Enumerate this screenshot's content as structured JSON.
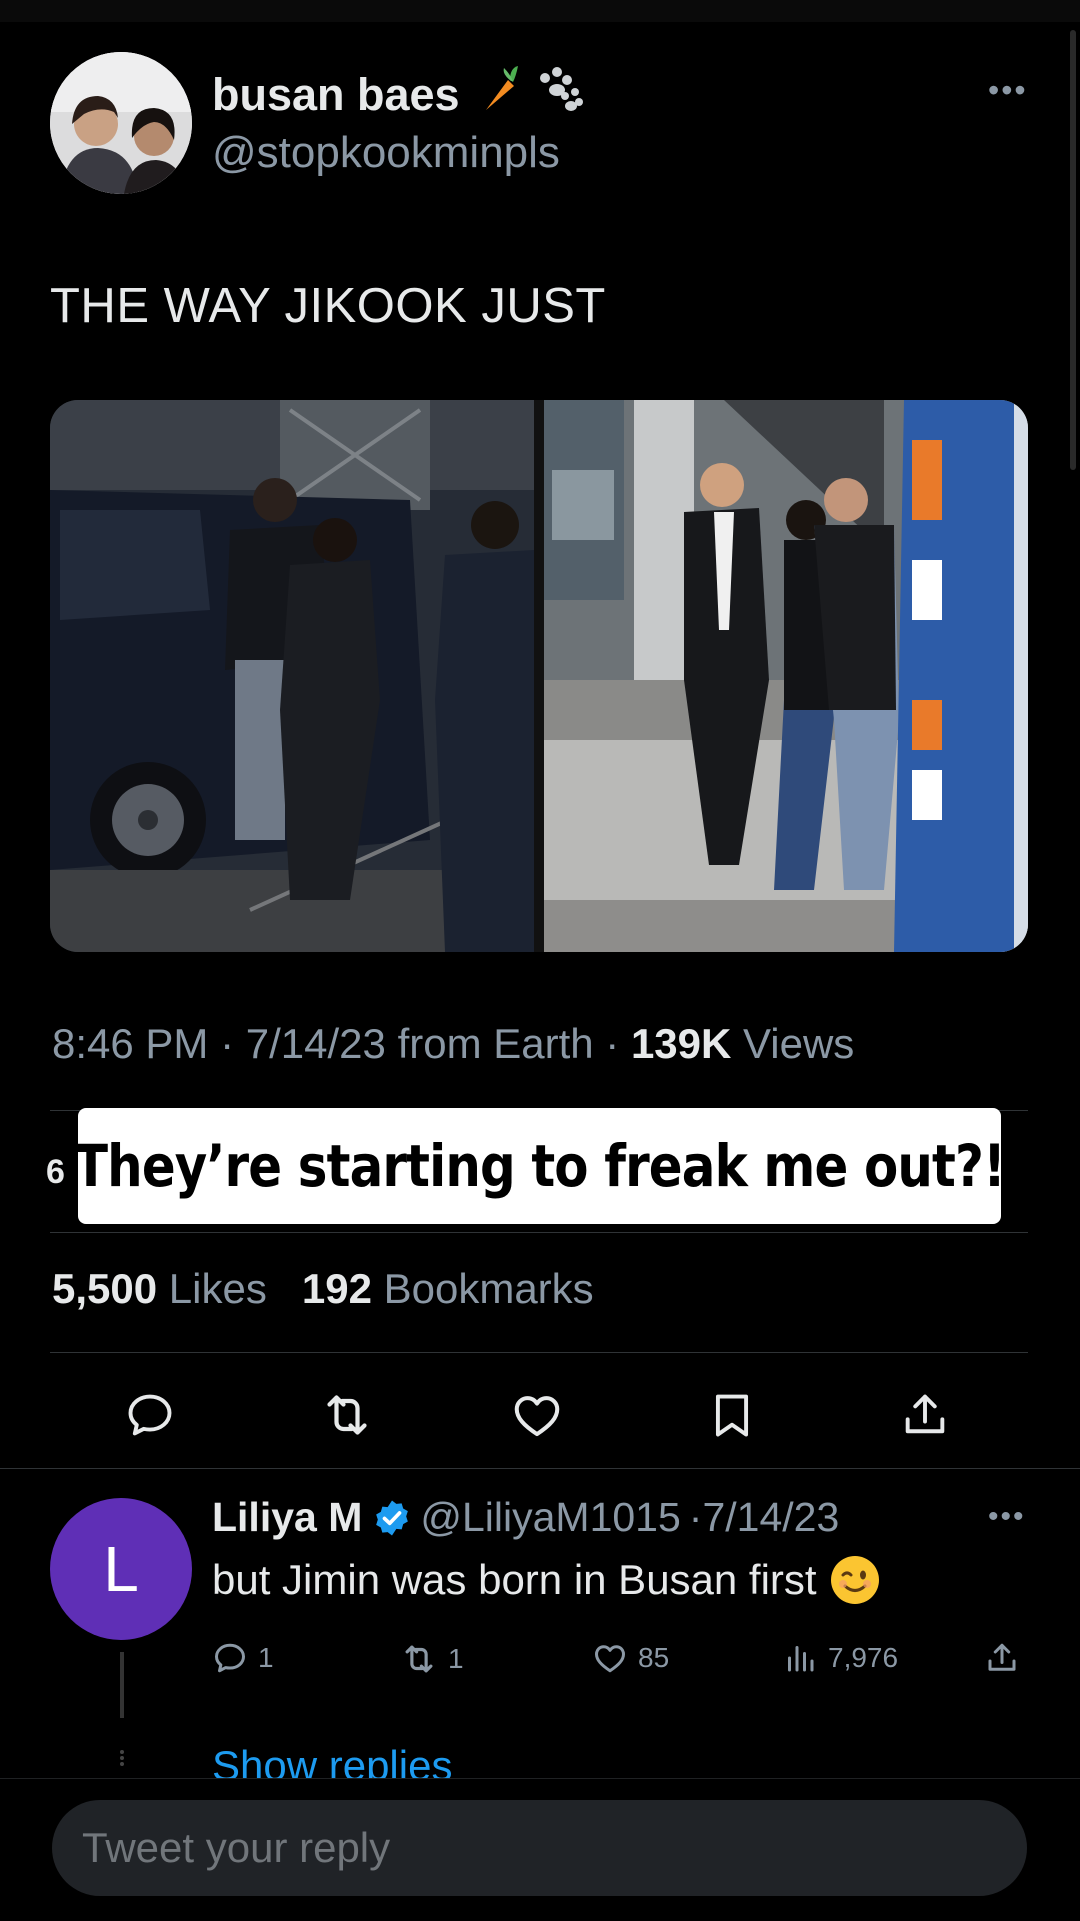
{
  "author": {
    "name": "busan baes",
    "handle": "@stopkookminpls",
    "emoji_icons": [
      "carrot-icon",
      "paw-icon"
    ]
  },
  "tweet": {
    "text": "THE WAY JIKOOK JUST",
    "time": "8:46 PM",
    "date": "7/14/23",
    "source": "from Earth",
    "views_count": "139K",
    "views_label": "Views",
    "likes_count": "5,500",
    "likes_label": "Likes",
    "bookmarks_count": "192",
    "bookmarks_label": "Bookmarks",
    "partially_hidden_count": "6"
  },
  "caption_overlay": "They’re starting to freak me out?!",
  "actions": [
    "reply-icon",
    "retweet-icon",
    "like-icon",
    "bookmark-icon",
    "share-icon"
  ],
  "reply": {
    "avatar_letter": "L",
    "name": "Liliya M",
    "handle": "@LiliyaM1015",
    "date": "7/14/23",
    "text": "but Jimin was born in Busan first",
    "emoji": "winking-face-emoji",
    "reply_count": "1",
    "retweet_count": "1",
    "like_count": "85",
    "views_count": "7,976",
    "show_replies": "Show replies"
  },
  "composer": {
    "placeholder": "Tweet your reply"
  },
  "colors": {
    "background": "#000000",
    "text": "#e7e9ea",
    "muted": "#8b98a5",
    "link": "#1d9bf0",
    "reply_avatar": "#5f2fb6"
  }
}
